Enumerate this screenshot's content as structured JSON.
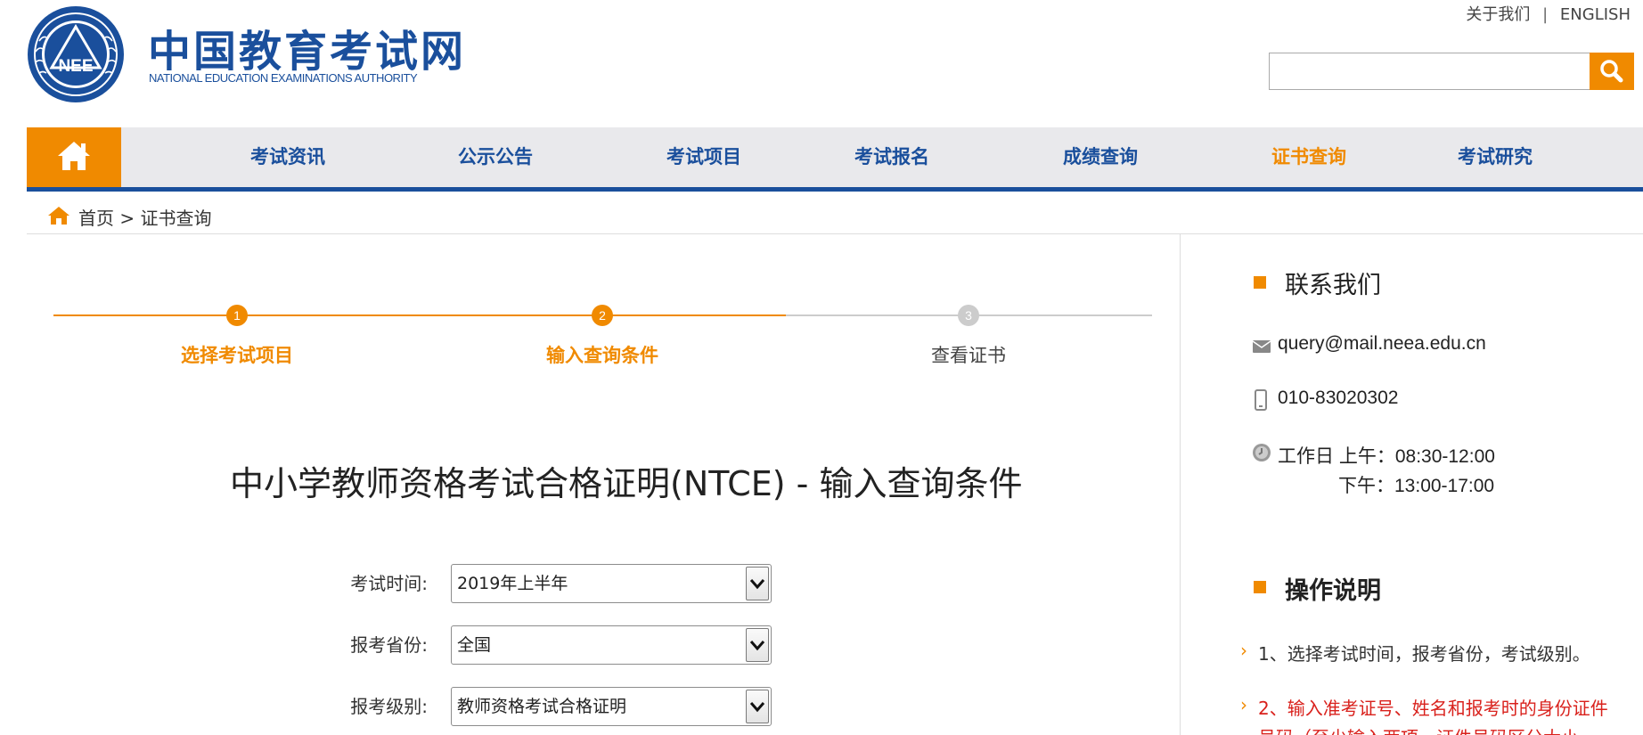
{
  "header": {
    "logo_title": "中国教育考试网",
    "logo_subtitle": "NATIONAL EDUCATION EXAMINATIONS AUTHORITY",
    "emblem_text": "NEE",
    "links": {
      "about": "关于我们",
      "separator": "|",
      "english": "ENGLISH"
    },
    "search": {
      "value": "",
      "placeholder": ""
    }
  },
  "colors": {
    "brand_blue": "#1a4f9c",
    "accent_orange": "#f08a00",
    "nav_bg": "#e9e9ec",
    "warn_red": "#d9211c"
  },
  "nav": {
    "home_icon": "home-icon",
    "items": [
      {
        "label": "考试资讯"
      },
      {
        "label": "公示公告"
      },
      {
        "label": "考试项目"
      },
      {
        "label": "考试报名"
      },
      {
        "label": "成绩查询"
      },
      {
        "label": "证书查询",
        "active": true
      },
      {
        "label": "考试研究"
      }
    ]
  },
  "breadcrumb": {
    "home": "首页",
    "separator": ">",
    "current": "证书查询"
  },
  "steps": [
    {
      "number": "1",
      "label": "选择考试项目",
      "state": "done"
    },
    {
      "number": "2",
      "label": "输入查询条件",
      "state": "current"
    },
    {
      "number": "3",
      "label": "查看证书",
      "state": "pending"
    }
  ],
  "main": {
    "title": "中小学教师资格考试合格证明(NTCE) - 输入查询条件",
    "form": [
      {
        "label": "考试时间:",
        "value": "2019年上半年"
      },
      {
        "label": "报考省份:",
        "value": "全国"
      },
      {
        "label": "报考级别:",
        "value": "教师资格考试合格证明"
      }
    ]
  },
  "sidebar": {
    "contact": {
      "heading": "联系我们",
      "email": "query@mail.neea.edu.cn",
      "phone": "010-83020302",
      "hours_line1": "工作日 上午：08:30-12:00",
      "hours_line2": "下午：13:00-17:00"
    },
    "instructions": {
      "heading": "操作说明",
      "item1": "1、选择考试时间，报考省份，考试级别。",
      "item2_line1": "2、输入准考证号、姓名和报考时的身份证件",
      "item2_line2": "号码（至少输入两项，证件号码区分大小"
    }
  }
}
